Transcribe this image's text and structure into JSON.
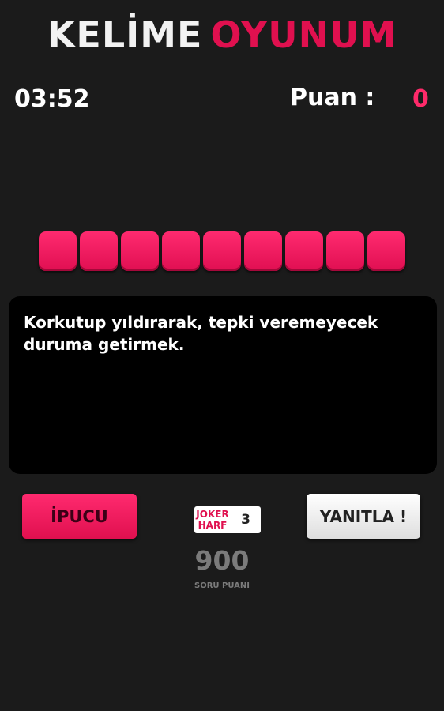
{
  "header": {
    "title_part1": "KELİME",
    "title_part2": "OYUNUM"
  },
  "status": {
    "timer": "03:52",
    "score_label": "Puan :",
    "score_value": "0"
  },
  "word": {
    "letter_count": 9
  },
  "clue": {
    "text": "Korkutup yıldırarak, tepki veremeyecek duruma getirmek."
  },
  "actions": {
    "hint_label": "İPUCU",
    "joker_label_line1": "JOKER",
    "joker_label_line2": "HARF",
    "joker_count": "3",
    "answer_label": "YANITLA !"
  },
  "question": {
    "points": "900",
    "points_label": "SORU PUANI"
  },
  "colors": {
    "accent": "#e0104f",
    "background": "#1b1b1b",
    "clue_bg": "#000000"
  }
}
